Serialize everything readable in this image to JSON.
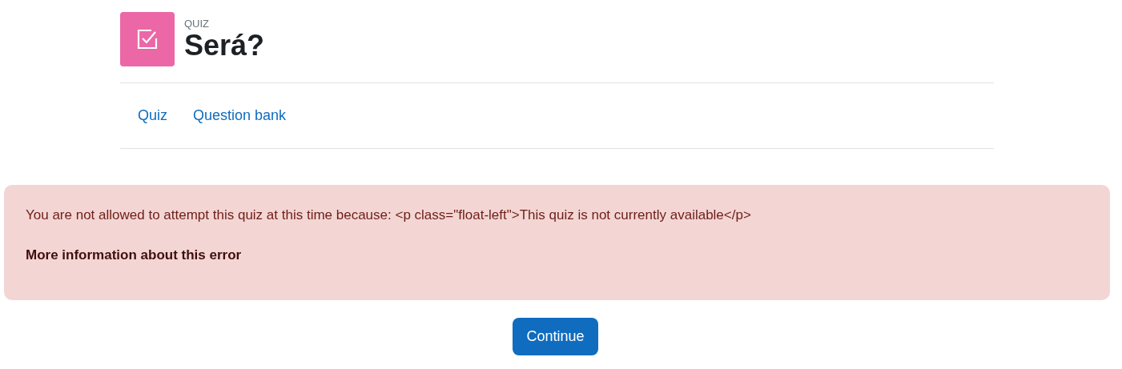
{
  "header": {
    "module_label": "QUIZ",
    "title": "Será?"
  },
  "tabs": [
    {
      "label": "Quiz"
    },
    {
      "label": "Question bank"
    }
  ],
  "alert": {
    "message": "You are not allowed to attempt this quiz at this time because: <p class=\"float-left\">This quiz is not currently available</p>",
    "more_info": "More information about this error"
  },
  "buttons": [
    "Continue"
  ]
}
